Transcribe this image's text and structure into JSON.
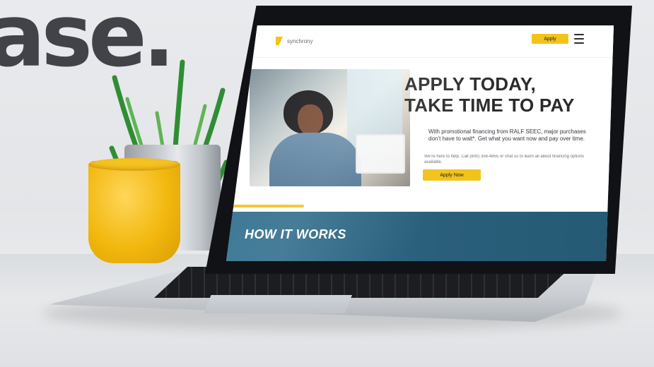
{
  "scene": {
    "background_word": "ase."
  },
  "site": {
    "brand_name": "synchrony",
    "header_button": "Apply",
    "hero_title_line1": "APPLY TODAY,",
    "hero_title_line2": "TAKE TIME TO PAY",
    "hero_body": "With promotional financing from RALF SEEC, major purchases don’t have to wait*. Get what you want now and pay over time.",
    "hero_fineprint": "We’re here to help. Call (800) 356-4855 or chat us to learn all about financing options available.",
    "hero_cta": "Apply Now",
    "section_title": "HOW IT WORKS"
  },
  "colors": {
    "accent_yellow": "#F2C31B",
    "section_teal": "#2A5F7B",
    "text_dark": "#2A2A2C"
  },
  "icons": {
    "menu": "hamburger-menu-icon",
    "brand": "synchrony-logo-icon"
  }
}
